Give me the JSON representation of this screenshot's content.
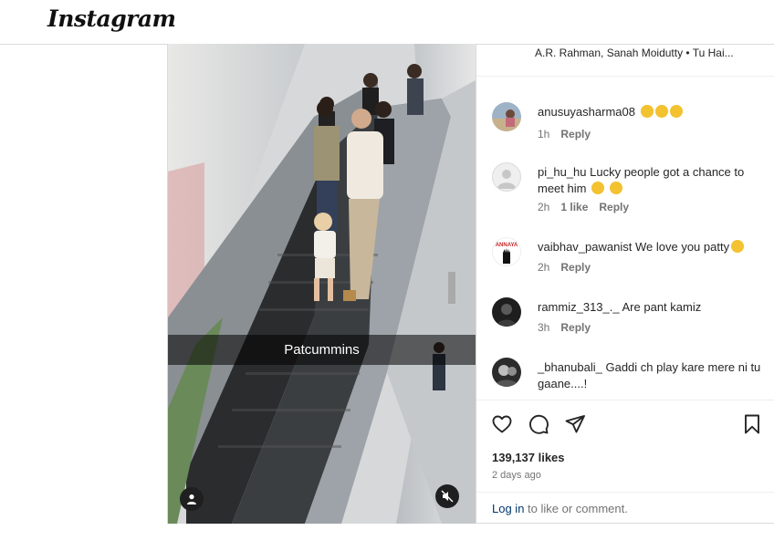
{
  "app": {
    "logo_text": "Instagram"
  },
  "media": {
    "caption": "Patcummins",
    "tag_icon": "user-icon",
    "mute_icon": "speaker-muted-icon"
  },
  "audio": {
    "artists": "A.R. Rahman, Sanah Moidutty • Tu Hai..."
  },
  "comments": [
    {
      "username": "anusuyasharma08",
      "text": "",
      "emojis": [
        "heart-eyes",
        "heart-eyes",
        "heart-eyes"
      ],
      "time": "1h",
      "likes": "",
      "reply": "Reply",
      "avatar": "photo"
    },
    {
      "username": "pi_hu_hu",
      "text": "Lucky people got a chance to meet him",
      "emojis": [
        "pleading",
        "yawn"
      ],
      "time": "2h",
      "likes": "1 like",
      "reply": "Reply",
      "avatar": "default"
    },
    {
      "username": "vaibhav_pawanist",
      "text": "We love you patty",
      "emojis": [
        "heart-eyes"
      ],
      "time": "2h",
      "likes": "",
      "reply": "Reply",
      "avatar": "logo",
      "avatar_text": "ANNAYA"
    },
    {
      "username": "rammiz_313_._",
      "text": "Are pant kamiz",
      "emojis": [],
      "time": "3h",
      "likes": "",
      "reply": "Reply",
      "avatar": "dark"
    },
    {
      "username": "_bhanubali_",
      "text": "Gaddi ch play kare mere ni tu gaane....!",
      "emojis": [],
      "time": "",
      "likes": "",
      "reply": "",
      "avatar": "bw"
    }
  ],
  "actions": {
    "like_icon": "heart-icon",
    "comment_icon": "comment-icon",
    "share_icon": "send-icon",
    "save_icon": "bookmark-icon"
  },
  "stats": {
    "likes": "139,137 likes",
    "date": "2 days ago"
  },
  "login": {
    "link": "Log in",
    "rest": " to like or comment."
  },
  "colors": {
    "link": "#00376b",
    "muted": "#737373",
    "text": "#262626",
    "border": "#dbdbdb"
  }
}
